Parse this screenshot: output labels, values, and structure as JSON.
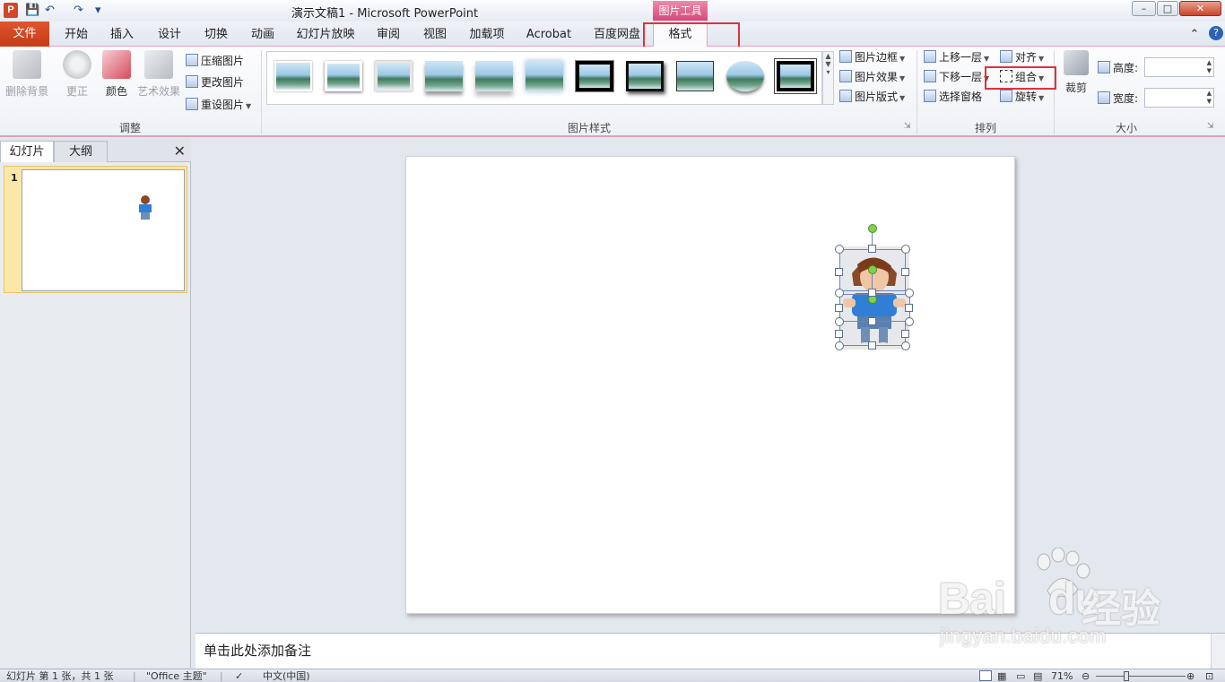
{
  "window": {
    "title": "演示文稿1 - Microsoft PowerPoint",
    "contextual_group": "图片工具",
    "app_icon_letter": "P",
    "controls": {
      "minimize": "–",
      "maximize": "□",
      "close": "✕"
    }
  },
  "quick_access": {
    "save": "💾",
    "undo": "↶",
    "redo": "↷",
    "customize": "▾"
  },
  "tabs": {
    "file": "文件",
    "items": [
      "开始",
      "插入",
      "设计",
      "切换",
      "动画",
      "幻灯片放映",
      "审阅",
      "视图",
      "加载项",
      "Acrobat",
      "百度网盘"
    ],
    "active": "格式",
    "help_caret": "⌃",
    "help": "?"
  },
  "ribbon": {
    "adjust": {
      "label": "调整",
      "remove_bg": "删除背景",
      "corrections": "更正",
      "color": "颜色",
      "artistic": "艺术效果",
      "compress": "压缩图片",
      "change": "更改图片",
      "reset": "重设图片"
    },
    "picture_styles": {
      "label": "图片样式",
      "border": "图片边框",
      "effects": "图片效果",
      "layout": "图片版式"
    },
    "arrange": {
      "label": "排列",
      "bring_forward": "上移一层",
      "send_backward": "下移一层",
      "selection_pane": "选择窗格",
      "align": "对齐",
      "group": "组合",
      "rotate": "旋转"
    },
    "size": {
      "label": "大小",
      "crop": "裁剪",
      "height_label": "高度:",
      "width_label": "宽度:",
      "height_value": "",
      "width_value": ""
    }
  },
  "left_pane": {
    "tab_slides": "幻灯片",
    "tab_outline": "大纲",
    "close": "✕",
    "slide_number": "1"
  },
  "notes": {
    "placeholder": "单击此处添加备注"
  },
  "status": {
    "slide_info": "幻灯片 第 1 张，共 1 张",
    "theme": "\"Office 主题\"",
    "language": "中文(中国)",
    "zoom": "71%"
  },
  "watermark": {
    "brand": "Bai",
    "brand_tail": "du",
    "cn": "经验",
    "url": "jingyan.baidu.com"
  },
  "colors": {
    "file_tab": "#d24726",
    "context_tab": "#d6477a",
    "highlight_box": "#e0313c",
    "selection_handle": "#5a6f92",
    "rotation_handle": "#7fd24a"
  }
}
